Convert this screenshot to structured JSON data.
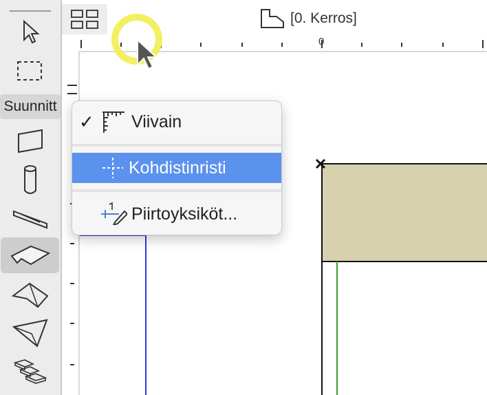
{
  "toolbox": {
    "section_label": "Suunnitt"
  },
  "header": {
    "story_label": "[0. Kerros]",
    "ruler_zero": "0"
  },
  "context_menu": {
    "items": [
      {
        "label": "Viivain",
        "checked": true,
        "icon": "ruler-icon"
      },
      {
        "label": "Kohdistinristi",
        "checked": false,
        "icon": "crosshair-icon",
        "highlighted": true
      },
      {
        "label": "Piirtoyksiköt...",
        "checked": false,
        "icon": "drawing-units-icon"
      }
    ]
  },
  "colors": {
    "slab_fill": "#d8d1b0",
    "highlight": "#5b92ee",
    "wall_blue": "#2a3dd8",
    "wall_green": "#3c9a2e",
    "cursor_ring": "#f2ef63"
  }
}
